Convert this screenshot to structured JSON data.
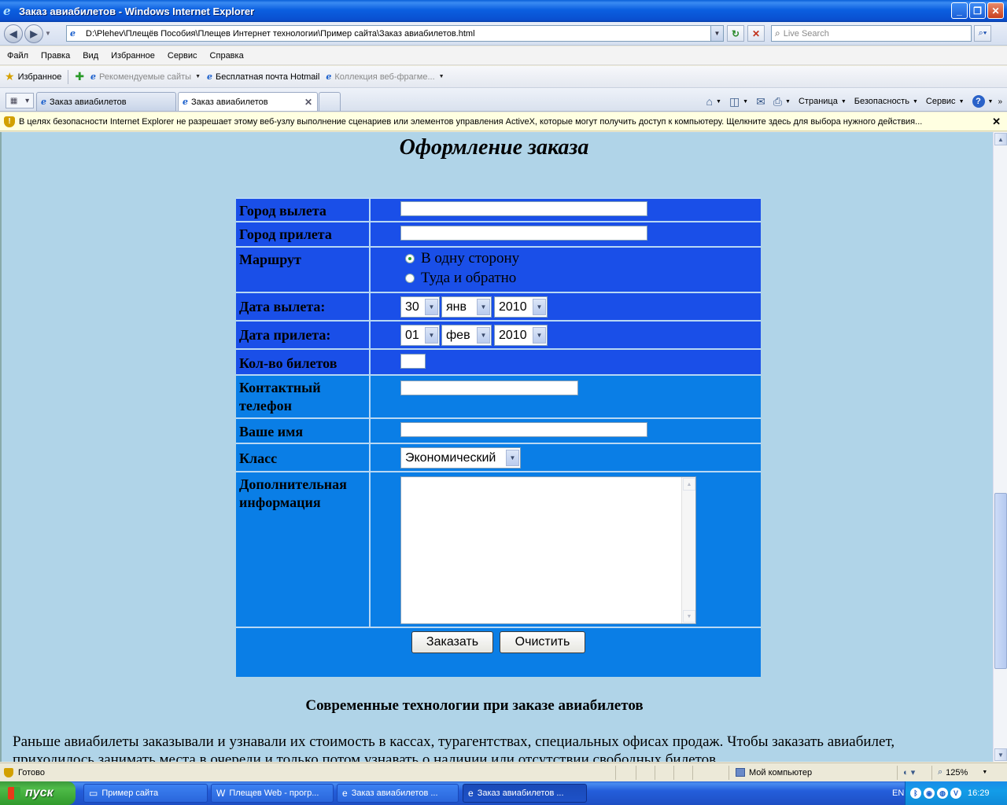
{
  "window": {
    "title": "Заказ авиабилетов - Windows Internet Explorer",
    "minimize": "_",
    "maximize": "❐",
    "close": "✕"
  },
  "addressbar": {
    "url": "D:\\Plehev\\Плещёв Пособия\\Плещев Интернет технологии\\Пример сайта\\Заказ авиабилетов.html",
    "search_placeholder": "Live Search"
  },
  "menu": [
    "Файл",
    "Правка",
    "Вид",
    "Избранное",
    "Сервис",
    "Справка"
  ],
  "favorites": {
    "label": "Избранное",
    "links": [
      "Рекомендуемые сайты",
      "Бесплатная почта Hotmail",
      "Коллекция веб-фрагме..."
    ]
  },
  "tabs": [
    "Заказ авиабилетов",
    "Заказ авиабилетов"
  ],
  "commandbar": {
    "page": "Страница",
    "safety": "Безопасность",
    "tools": "Сервис"
  },
  "infobar": {
    "text": "В целях безопасности Internet Explorer не разрешает этому веб-узлу выполнение сценариев или элементов управления ActiveX, которые могут получить доступ к компьютеру. Щелкните здесь для выбора нужного действия..."
  },
  "page": {
    "title": "Оформление заказа",
    "form": {
      "departure_city": "Город вылета",
      "arrival_city": "Город прилета",
      "route": "Маршрут",
      "route_one_way": "В одну сторону",
      "route_round_trip": "Туда и обратно",
      "departure_date": "Дата вылета:",
      "dep_day": "30",
      "dep_month": "янв",
      "dep_year": "2010",
      "arrival_date": "Дата прилета:",
      "arr_day": "01",
      "arr_month": "фев",
      "arr_year": "2010",
      "tickets": "Кол-во билетов",
      "phone_line1": "Контактный",
      "phone_line2": "телефон",
      "name": "Ваше имя",
      "class": "Класс",
      "class_value": "Экономический",
      "extra_line1": "Дополнительная",
      "extra_line2": "информация",
      "submit": "Заказать",
      "reset": "Очистить"
    },
    "section_title": "Современные технологии при заказе авиабилетов",
    "paragraph": "Раньше авиабилеты заказывали и узнавали их стоимость в кассах, турагентствах, специальных офисах продаж. Чтобы заказать авиабилет, приходилось занимать места в очереди и только потом узнавать о наличии или отсутствии свободных билетов."
  },
  "status": {
    "text": "Готово",
    "zone": "Мой компьютер",
    "zoom": "125%"
  },
  "taskbar": {
    "start": "пуск",
    "tasks": [
      "Пример сайта",
      "Плещев Web - прогр...",
      "Заказ авиабилетов ...",
      "Заказ авиабилетов ..."
    ],
    "lang": "EN",
    "time": "16:29"
  }
}
